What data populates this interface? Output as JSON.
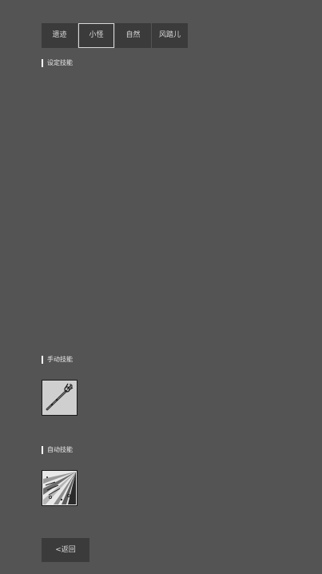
{
  "tabs": [
    {
      "label": "遗迹",
      "active": false
    },
    {
      "label": "小怪",
      "active": true
    },
    {
      "label": "自然",
      "active": false
    },
    {
      "label": "风踏儿",
      "active": false
    }
  ],
  "sections": {
    "equipped_skills": "设定技能",
    "manual_skills": "手动技能",
    "auto_skills": "自动技能"
  },
  "manual_skills": [
    {
      "icon": "staff-skill-icon"
    }
  ],
  "auto_skills": [
    {
      "icon": "arrow-rain-skill-icon"
    }
  ],
  "back_label": "<返回"
}
